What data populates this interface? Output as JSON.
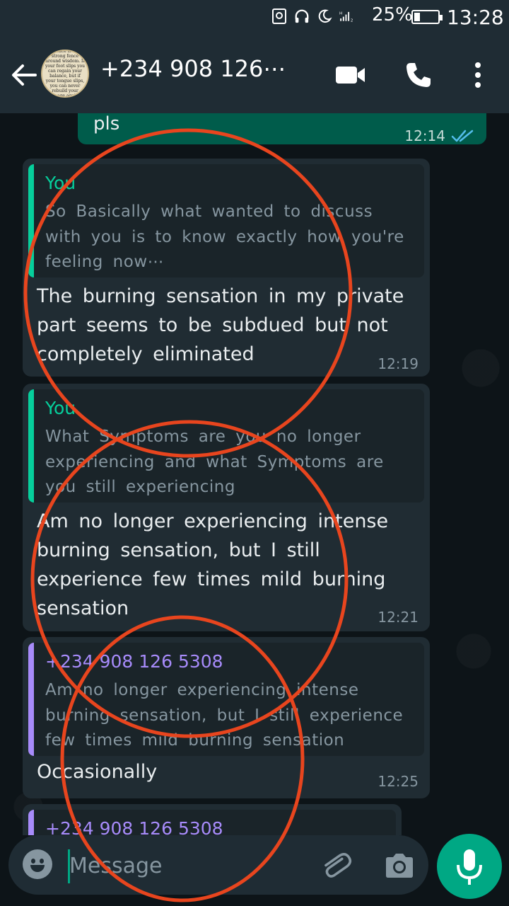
{
  "status_bar": {
    "battery": "25%",
    "time": "13:28"
  },
  "header": {
    "contact_name": "+234  908  126⋯",
    "avatar_text": "Silence is the strong fence around wisdom. If your foot slips you can regain your balance, but if your tongue slips, you can never rebuild your image again"
  },
  "messages": [
    {
      "direction": "out",
      "text": "pls",
      "time": "12:14",
      "status": "read"
    },
    {
      "direction": "in",
      "quote": {
        "author": "You",
        "author_color": "#06cf9c",
        "text": "So Basically what wanted to discuss with you is to know exactly how you're feeling now⋯"
      },
      "text": "The burning sensation in my private part seems to be subdued but not completely eliminated",
      "time": "12:19"
    },
    {
      "direction": "in",
      "quote": {
        "author": "You",
        "author_color": "#06cf9c",
        "text": "What Symptoms are you no longer experiencing and what Symptoms are you still experiencing"
      },
      "text": "Am no longer experiencing intense burning sensation, but I still experience few times mild burning sensation",
      "time": "12:21"
    },
    {
      "direction": "in",
      "quote": {
        "author": "+234  908  126  5308",
        "author_color": "#a78bfa",
        "text": "Am no longer experiencing intense burning sensation, but I still experience few times mild burning sensation"
      },
      "text": "Occasionally",
      "time": "12:25"
    },
    {
      "direction": "in",
      "quote": {
        "author": "+234  908  126  5308",
        "author_color": "#a78bfa",
        "text": ""
      },
      "text": "",
      "time": ""
    }
  ],
  "input": {
    "placeholder": "Message",
    "value": ""
  },
  "icons": {
    "status": [
      "screenshot-icon",
      "headphones-icon",
      "moon-icon",
      "signal-icon"
    ],
    "header": [
      "back-arrow-icon",
      "video-call-icon",
      "phone-icon",
      "more-options-icon"
    ],
    "input": [
      "emoji-icon",
      "attach-icon",
      "camera-icon",
      "mic-icon"
    ]
  },
  "colors": {
    "accent": "#00a884",
    "outgoing_bubble": "#005c4b",
    "incoming_bubble": "#202c33",
    "annotation": "#e8451e"
  }
}
